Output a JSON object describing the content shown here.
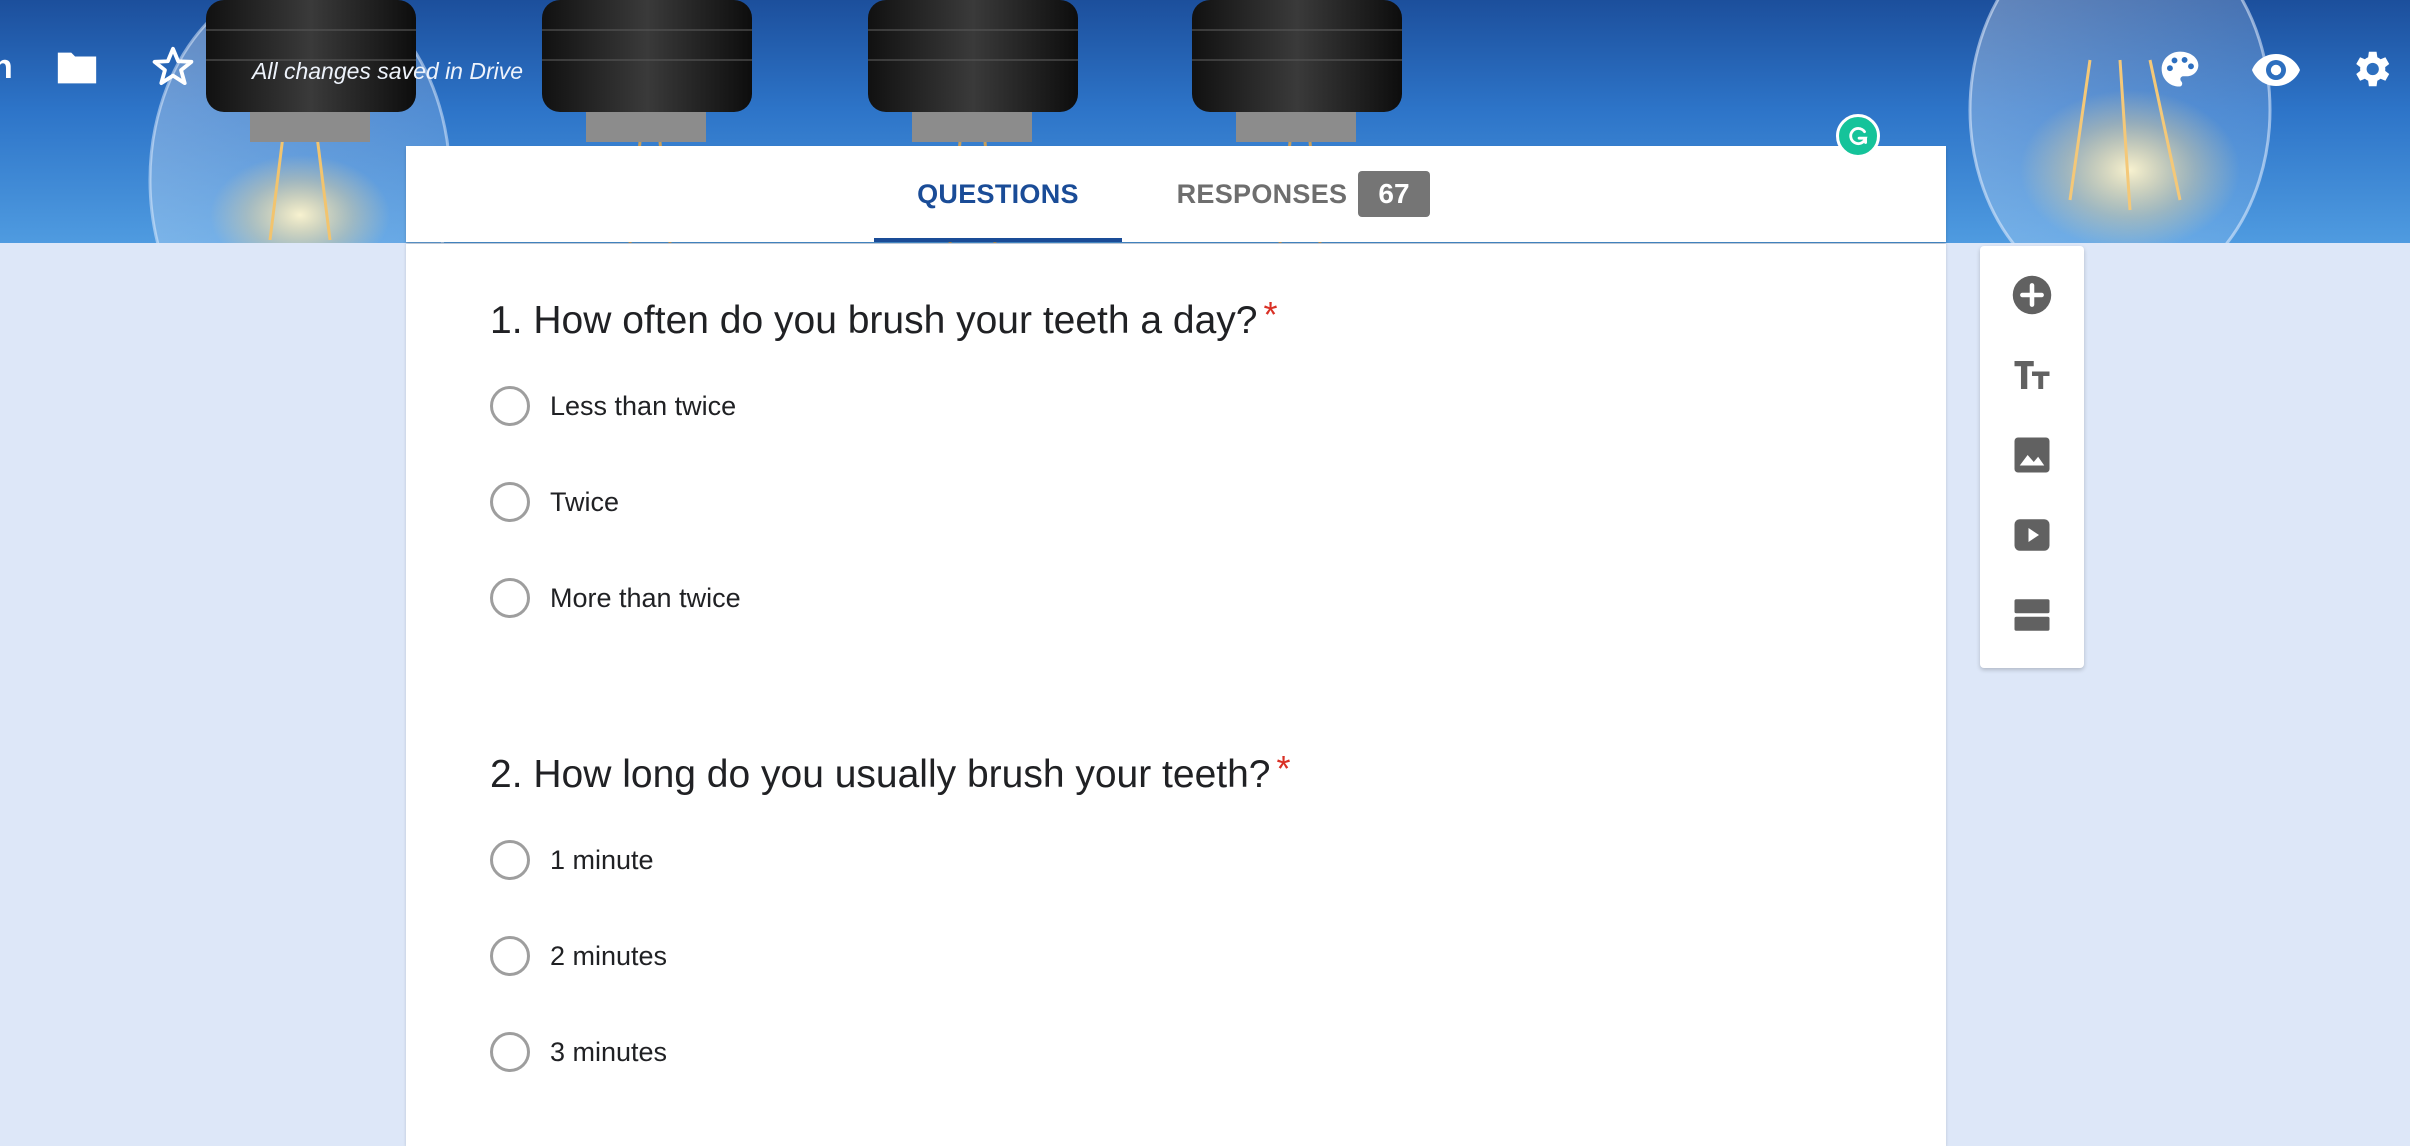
{
  "header": {
    "title_fragment": "n",
    "save_status": "All changes saved in Drive",
    "icons": [
      "folder-icon",
      "star-icon",
      "palette-icon",
      "eye-icon",
      "gear-icon"
    ]
  },
  "tabs": {
    "questions_label": "QUESTIONS",
    "responses_label": "RESPONSES",
    "responses_count": "67"
  },
  "questions": [
    {
      "title": "1. How often do you brush your teeth a day?",
      "required_mark": "*",
      "options": [
        "Less than twice",
        "Twice",
        "More than twice"
      ]
    },
    {
      "title": "2. How long do you usually brush your teeth?",
      "required_mark": "*",
      "options": [
        "1 minute",
        "2 minutes",
        "3 minutes"
      ]
    }
  ],
  "toolbar": {
    "tools": [
      "add-question-icon",
      "add-title-icon",
      "add-image-icon",
      "add-video-icon",
      "add-section-icon"
    ]
  },
  "colors": {
    "accent": "#1a4c97",
    "required": "#d93025",
    "page_background": "#dde7f8",
    "badge": "#757575",
    "grammarly": "#15c39a"
  }
}
